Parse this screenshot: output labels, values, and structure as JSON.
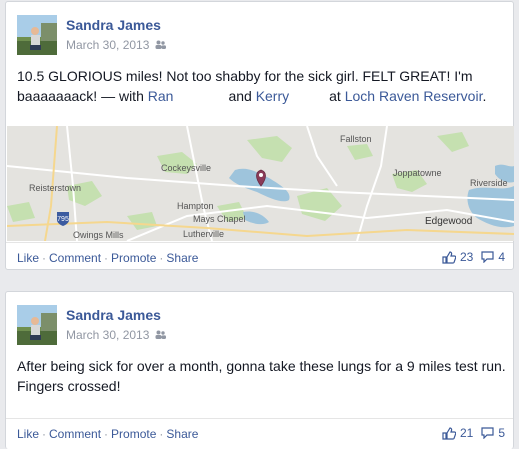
{
  "posts": [
    {
      "author": "Sandra James",
      "date": "March 30, 2013",
      "audience_icon": "friends-icon",
      "text_part1": "10.5 GLORIOUS miles! Not too shabby for the sick girl. FELT GREAT! I'm baaaaaaack! — with ",
      "tag1": "Ran",
      "text_and": "and ",
      "tag2": "Kerry",
      "text_at": "at ",
      "place": "Loch Raven Reservoir",
      "text_end": ".",
      "map_labels": {
        "fallston": "Fallston",
        "cockeysville": "Cockeysville",
        "reisterstown": "Reisterstown",
        "hampton": "Hampton",
        "mays_chapel": "Mays Chapel",
        "joppatowne": "Joppatowne",
        "riverside": "Riverside",
        "edgewood": "Edgewood",
        "lutherville": "Lutherville",
        "owings_mills": "Owings Mills",
        "route": "795"
      },
      "actions": {
        "like": "Like",
        "comment": "Comment",
        "promote": "Promote",
        "share": "Share",
        "sep": "·"
      },
      "likes": "23",
      "comments": "4"
    },
    {
      "author": "Sandra James",
      "date": "March 30, 2013",
      "audience_icon": "friends-icon",
      "text": "After being sick for over a month, gonna take these lungs for a 9 miles test run. Fingers crossed!",
      "actions": {
        "like": "Like",
        "comment": "Comment",
        "promote": "Promote",
        "share": "Share",
        "sep": "·"
      },
      "likes": "21",
      "comments": "5"
    }
  ],
  "colors": {
    "link": "#3b5998",
    "meta": "#9197a3",
    "pin": "#8a3a57",
    "water": "#9ec4dc",
    "park": "#c5e0b0"
  }
}
